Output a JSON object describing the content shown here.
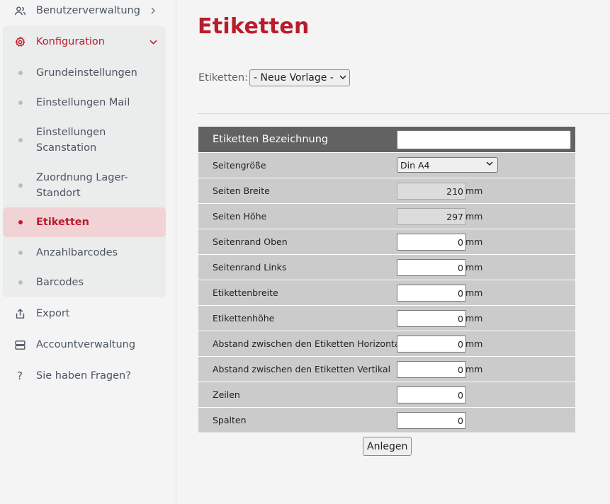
{
  "sidebar": {
    "top_item": "Benutzerverwaltung",
    "config": "Konfiguration",
    "sub_items": [
      "Grundeinstellungen",
      "Einstellungen Mail",
      "Einstellungen Scanstation",
      "Zuordnung Lager-Standort",
      "Etiketten",
      "Anzahlbarcodes",
      "Barcodes"
    ],
    "export": "Export",
    "account": "Accountverwaltung",
    "help": "Sie haben Fragen?"
  },
  "main": {
    "title": "Etiketten",
    "template_label": "Etiketten:",
    "template_selected": "- Neue Vorlage -",
    "form": {
      "name_label": "Etiketten Bezeichnung",
      "name_value": "",
      "page_size_label": "Seitengröße",
      "page_size_value": "Din A4",
      "unit": "mm",
      "rows": [
        {
          "label": "Seiten Breite",
          "value": "210",
          "unit": "mm"
        },
        {
          "label": "Seiten Höhe",
          "value": "297",
          "unit": "mm"
        },
        {
          "label": "Seitenrand Oben",
          "value": "0",
          "unit": "mm"
        },
        {
          "label": "Seitenrand Links",
          "value": "0",
          "unit": "mm"
        },
        {
          "label": "Etikettenbreite",
          "value": "0",
          "unit": "mm"
        },
        {
          "label": "Etikettenhöhe",
          "value": "0",
          "unit": "mm"
        },
        {
          "label": "Abstand zwischen den Etiketten Horizontal",
          "value": "0",
          "unit": "mm"
        },
        {
          "label": "Abstand zwischen den Etiketten Vertikal",
          "value": "0",
          "unit": "mm"
        },
        {
          "label": "Zeilen",
          "value": "0",
          "unit": ""
        },
        {
          "label": "Spalten",
          "value": "0",
          "unit": ""
        }
      ]
    },
    "submit_label": "Anlegen"
  },
  "colors": {
    "accent": "#b91c2c",
    "header_row": "#626262",
    "row_bg": "#cbcbcb",
    "selected_bg": "#f1d3d6"
  }
}
